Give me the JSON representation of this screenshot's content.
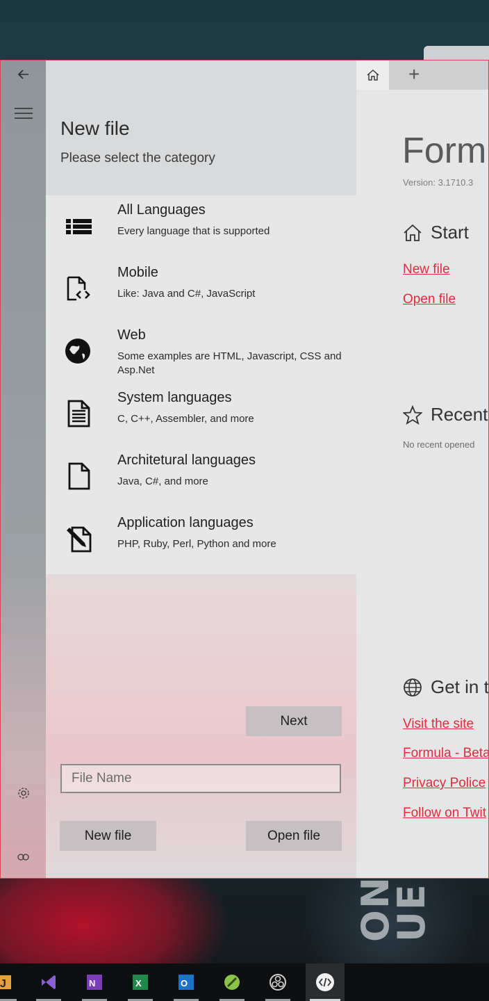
{
  "flyout": {
    "title": "New file",
    "subtitle": "Please select the category",
    "categories": [
      {
        "title": "All Languages",
        "desc": "Every language that is supported",
        "icon": "list-icon"
      },
      {
        "title": "Mobile",
        "desc": "Like: Java and C#, JavaScript",
        "icon": "code-file-icon"
      },
      {
        "title": "Web",
        "desc": "Some examples are HTML, Javascript, CSS and Asp.Net",
        "icon": "globe-icon"
      },
      {
        "title": "System languages",
        "desc": "C, C++, Assembler, and more",
        "icon": "document-icon"
      },
      {
        "title": "Architetural languages",
        "desc": "Java, C#, and more",
        "icon": "page-icon"
      },
      {
        "title": "Application languages",
        "desc": "PHP, Ruby, Perl, Python and more",
        "icon": "edit-file-icon"
      }
    ],
    "next_label": "Next",
    "filename_placeholder": "File Name",
    "new_file_label": "New file",
    "open_file_label": "Open file"
  },
  "content": {
    "title": "Form",
    "version": "Version: 3.1710.3",
    "start": {
      "heading": "Start",
      "new_file": "New file",
      "open_file": "Open file"
    },
    "recent": {
      "heading": "Recent",
      "empty": "No recent opened"
    },
    "contact": {
      "heading": "Get in t",
      "links": [
        "Visit the site",
        "Formula - Beta",
        "Privacy Police",
        "Follow on Twit"
      ]
    }
  },
  "taskbar": {
    "apps": [
      "app-icon",
      "visual-studio-icon",
      "onenote-icon",
      "excel-icon",
      "outlook-icon",
      "green-app-icon",
      "obs-icon",
      "code-editor-icon"
    ],
    "active_app": "code-editor-icon"
  },
  "background": {
    "text": "ONE UE"
  },
  "colors": {
    "accent": "#e02b3f",
    "window_border": "#d8434f",
    "taskbar": "#0d0f10"
  }
}
